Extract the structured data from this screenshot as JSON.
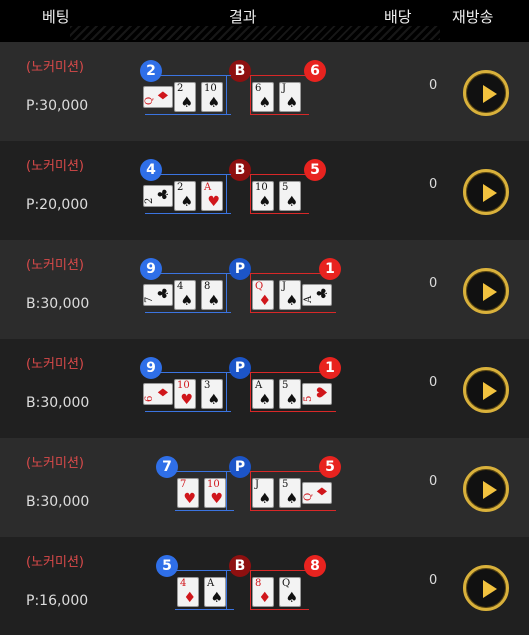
{
  "header": {
    "bet_label": "베팅",
    "result_label": "결과",
    "payout_label": "배당",
    "replay_label": "재방송"
  },
  "colors": {
    "player_blue": "#2f6fe8",
    "banker_red": "#e8231f",
    "commission_red": "#d94a4a",
    "replay_gold": "#d9b13b"
  },
  "rows": [
    {
      "commission": "(노커미션)",
      "bet": "P:30,000",
      "payout": "0",
      "player_score": "2",
      "banker_score": "6",
      "winner": "B",
      "player_cards": [
        {
          "rank": "Q",
          "suit": "♦"
        },
        {
          "rank": "2",
          "suit": "♠"
        },
        {
          "rank": "10",
          "suit": "♠"
        }
      ],
      "banker_cards": [
        {
          "rank": "6",
          "suit": "♠"
        },
        {
          "rank": "J",
          "suit": "♠"
        }
      ]
    },
    {
      "commission": "(노커미션)",
      "bet": "P:20,000",
      "payout": "0",
      "player_score": "4",
      "banker_score": "5",
      "winner": "B",
      "player_cards": [
        {
          "rank": "2",
          "suit": "♣"
        },
        {
          "rank": "2",
          "suit": "♠"
        },
        {
          "rank": "A",
          "suit": "♥"
        }
      ],
      "banker_cards": [
        {
          "rank": "10",
          "suit": "♠"
        },
        {
          "rank": "5",
          "suit": "♠"
        }
      ]
    },
    {
      "commission": "(노커미션)",
      "bet": "B:30,000",
      "payout": "0",
      "player_score": "9",
      "banker_score": "1",
      "winner": "P",
      "player_cards": [
        {
          "rank": "7",
          "suit": "♣"
        },
        {
          "rank": "4",
          "suit": "♠"
        },
        {
          "rank": "8",
          "suit": "♠"
        }
      ],
      "banker_cards": [
        {
          "rank": "Q",
          "suit": "♦"
        },
        {
          "rank": "J",
          "suit": "♠"
        },
        {
          "rank": "A",
          "suit": "♣"
        }
      ]
    },
    {
      "commission": "(노커미션)",
      "bet": "B:30,000",
      "payout": "0",
      "player_score": "9",
      "banker_score": "1",
      "winner": "P",
      "player_cards": [
        {
          "rank": "6",
          "suit": "♦"
        },
        {
          "rank": "10",
          "suit": "♥"
        },
        {
          "rank": "3",
          "suit": "♠"
        }
      ],
      "banker_cards": [
        {
          "rank": "A",
          "suit": "♠"
        },
        {
          "rank": "5",
          "suit": "♠"
        },
        {
          "rank": "5",
          "suit": "♥"
        }
      ]
    },
    {
      "commission": "(노커미션)",
      "bet": "B:30,000",
      "payout": "0",
      "player_score": "7",
      "banker_score": "5",
      "winner": "P",
      "player_cards": [
        {
          "rank": "7",
          "suit": "♥"
        },
        {
          "rank": "10",
          "suit": "♥"
        }
      ],
      "banker_cards": [
        {
          "rank": "J",
          "suit": "♠"
        },
        {
          "rank": "5",
          "suit": "♠"
        },
        {
          "rank": "Q",
          "suit": "♦"
        }
      ]
    },
    {
      "commission": "(노커미션)",
      "bet": "P:16,000",
      "payout": "0",
      "player_score": "5",
      "banker_score": "8",
      "winner": "B",
      "player_cards": [
        {
          "rank": "4",
          "suit": "♦"
        },
        {
          "rank": "A",
          "suit": "♠"
        }
      ],
      "banker_cards": [
        {
          "rank": "8",
          "suit": "♦"
        },
        {
          "rank": "Q",
          "suit": "♠"
        }
      ]
    }
  ]
}
